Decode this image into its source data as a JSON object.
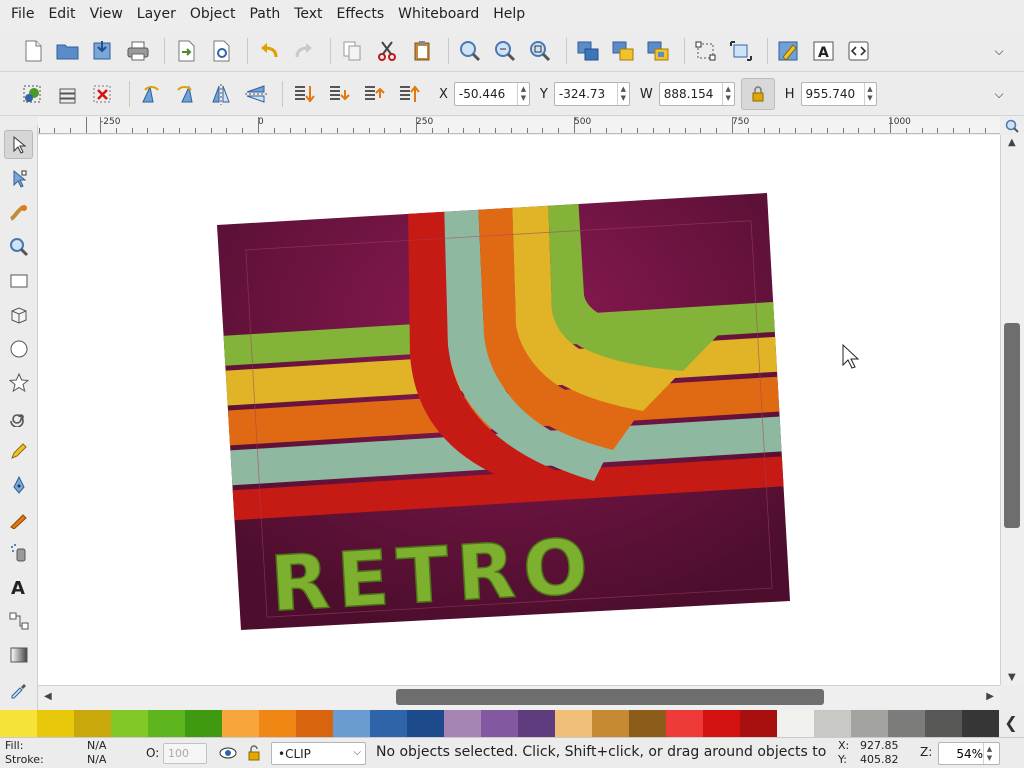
{
  "menu": [
    "File",
    "Edit",
    "View",
    "Layer",
    "Object",
    "Path",
    "Text",
    "Effects",
    "Whiteboard",
    "Help"
  ],
  "command_bar_icons": [
    "new-document-icon",
    "open-icon",
    "save-icon",
    "print-icon",
    "import-icon",
    "export-icon",
    "undo-icon",
    "redo-icon",
    "duplicate-icon",
    "cut-icon",
    "paste-icon",
    "zoom-selection-icon",
    "zoom-drawing-icon",
    "zoom-page-icon",
    "group-icon",
    "ungroup-icon",
    "clone-icon",
    "node-editor-icon",
    "transform-icon",
    "fill-stroke-icon",
    "text-font-icon",
    "xml-editor-icon"
  ],
  "controls": {
    "x_label": "X",
    "x_value": "-50.446",
    "y_label": "Y",
    "y_value": "-324.73",
    "w_label": "W",
    "w_value": "888.154",
    "h_label": "H",
    "h_value": "955.740"
  },
  "ruler_labels": [
    "-250",
    "0",
    "250",
    "500",
    "750",
    "1000"
  ],
  "artwork_text": "RETRO",
  "palette": [
    "#f7e23a",
    "#e8c80a",
    "#c9a80c",
    "#82c928",
    "#5fb51e",
    "#3f9a12",
    "#f7a63b",
    "#f08613",
    "#d9640e",
    "#6a9bd1",
    "#2f64a9",
    "#1d4a8a",
    "#a685b5",
    "#8258a0",
    "#5e3c7d",
    "#f0bf7a",
    "#c78a34",
    "#8c5d1a",
    "#ef3a3a",
    "#d41111",
    "#a80f0f",
    "#f1f1ed",
    "#c8c8c4",
    "#a3a3a0",
    "#7c7c7a",
    "#585857",
    "#363636"
  ],
  "status": {
    "fill_label": "Fill:",
    "fill_value": "N/A",
    "stroke_label": "Stroke:",
    "stroke_value": "N/A",
    "opacity_label": "O:",
    "opacity_value": "100",
    "layer": "•CLIP",
    "message": "No objects selected. Click, Shift+click, or drag around objects to select.",
    "cursor_x_label": "X:",
    "cursor_x": "927.85",
    "cursor_y_label": "Y:",
    "cursor_y": "405.82",
    "zoom_label": "Z:",
    "zoom_value": "54%"
  }
}
